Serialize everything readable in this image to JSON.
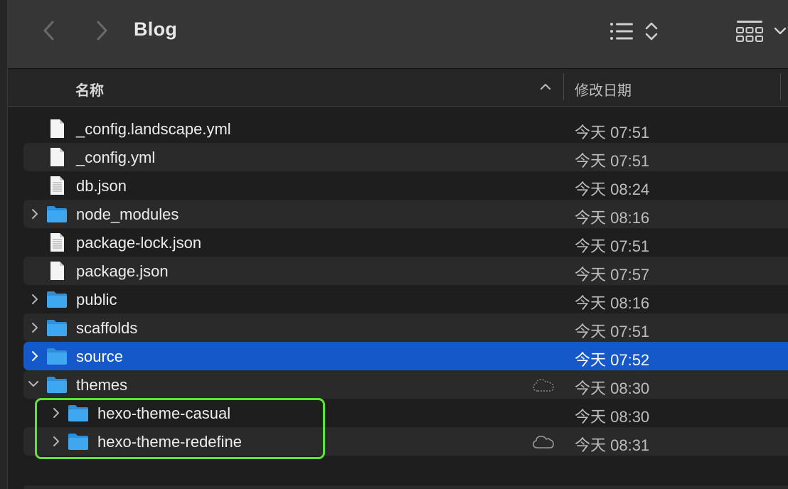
{
  "window": {
    "title": "Blog"
  },
  "toolbar": {
    "back_icon": "chevron-left-icon",
    "forward_icon": "chevron-right-icon",
    "view_icon": "list-view-icon",
    "sort_icon": "sort-arrows-icon",
    "group_icon": "icon-grid-icon",
    "dropdown_icon": "chevron-down-icon"
  },
  "header": {
    "name_label": "名称",
    "date_label": "修改日期",
    "sort_direction": "ascending"
  },
  "files": [
    {
      "name": "_config.landscape.yml",
      "date": "今天 07:51",
      "kind": "file",
      "expandable": false,
      "level": 0
    },
    {
      "name": "_config.yml",
      "date": "今天 07:51",
      "kind": "file",
      "expandable": false,
      "level": 0
    },
    {
      "name": "db.json",
      "date": "今天 08:24",
      "kind": "text-file",
      "expandable": false,
      "level": 0
    },
    {
      "name": "node_modules",
      "date": "今天 08:16",
      "kind": "folder",
      "expandable": true,
      "expanded": false,
      "level": 0
    },
    {
      "name": "package-lock.json",
      "date": "今天 07:51",
      "kind": "text-file",
      "expandable": false,
      "level": 0
    },
    {
      "name": "package.json",
      "date": "今天 07:57",
      "kind": "file",
      "expandable": false,
      "level": 0
    },
    {
      "name": "public",
      "date": "今天 08:16",
      "kind": "folder",
      "expandable": true,
      "expanded": false,
      "level": 0
    },
    {
      "name": "scaffolds",
      "date": "今天 07:51",
      "kind": "folder",
      "expandable": true,
      "expanded": false,
      "level": 0
    },
    {
      "name": "source",
      "date": "今天 07:52",
      "kind": "folder",
      "expandable": true,
      "expanded": false,
      "level": 0,
      "selected": true
    },
    {
      "name": "themes",
      "date": "今天 08:30",
      "kind": "folder",
      "expandable": true,
      "expanded": true,
      "level": 0,
      "cloud_status": "dashed-cloud-icon"
    },
    {
      "name": "hexo-theme-casual",
      "date": "今天 08:30",
      "kind": "folder",
      "expandable": true,
      "expanded": false,
      "level": 1
    },
    {
      "name": "hexo-theme-redefine",
      "date": "今天 08:31",
      "kind": "folder",
      "expandable": true,
      "expanded": false,
      "level": 1,
      "cloud_status": "cloud-icon"
    }
  ],
  "colors": {
    "selection": "#1558c9",
    "folder": "#3fa7f0",
    "highlight_outline": "#5ee23b"
  }
}
